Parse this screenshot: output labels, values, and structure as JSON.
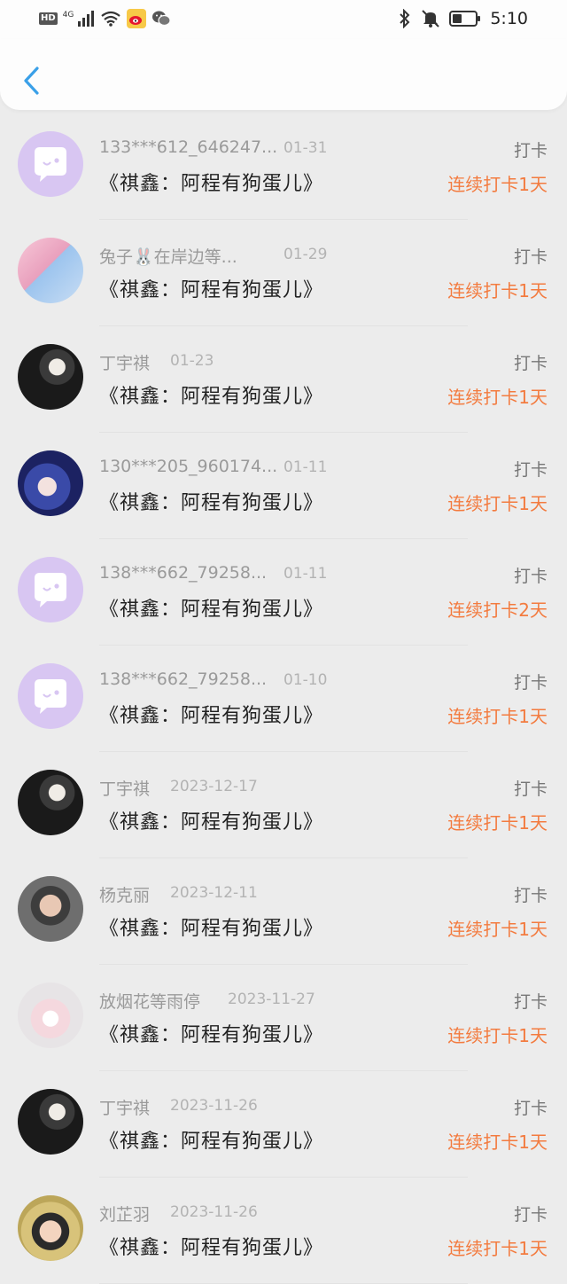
{
  "status_bar": {
    "hd": "HD",
    "network": "4G",
    "time": "5:10",
    "left_icons": [
      "hd-icon",
      "signal-icon",
      "wifi-icon",
      "weibo-icon",
      "wechat-icon"
    ],
    "right_icons": [
      "bluetooth-icon",
      "mute-icon",
      "battery-icon"
    ]
  },
  "header": {
    "back_icon": "chevron-left-icon",
    "accent": "#3aa0e8"
  },
  "colors": {
    "streak": "#f37b3f",
    "name": "#9a9a9a",
    "title": "#222222"
  },
  "records": [
    {
      "name": "133***612_646247...",
      "date": "01-31",
      "title": "《祺鑫：阿程有狗蛋儿》",
      "tag": "打卡",
      "streak": "连续打卡1天",
      "avatar": "purple-chat-icon"
    },
    {
      "name": "兔子🐰在岸边等...",
      "date": "01-29",
      "title": "《祺鑫：阿程有狗蛋儿》",
      "tag": "打卡",
      "streak": "连续打卡1天",
      "avatar": "photo-couple"
    },
    {
      "name": "丁宇祺",
      "date": "01-23",
      "title": "《祺鑫：阿程有狗蛋儿》",
      "tag": "打卡",
      "streak": "连续打卡1天",
      "avatar": "photo-dark"
    },
    {
      "name": "130***205_960174...",
      "date": "01-11",
      "title": "《祺鑫：阿程有狗蛋儿》",
      "tag": "打卡",
      "streak": "连续打卡1天",
      "avatar": "photo-blue"
    },
    {
      "name": "138***662_79258...",
      "date": "01-11",
      "title": "《祺鑫：阿程有狗蛋儿》",
      "tag": "打卡",
      "streak": "连续打卡2天",
      "avatar": "purple-chat-icon"
    },
    {
      "name": "138***662_79258...",
      "date": "01-10",
      "title": "《祺鑫：阿程有狗蛋儿》",
      "tag": "打卡",
      "streak": "连续打卡1天",
      "avatar": "purple-chat-icon"
    },
    {
      "name": "丁宇祺",
      "date": "2023-12-17",
      "title": "《祺鑫：阿程有狗蛋儿》",
      "tag": "打卡",
      "streak": "连续打卡1天",
      "avatar": "photo-dark"
    },
    {
      "name": "杨克丽",
      "date": "2023-12-11",
      "title": "《祺鑫：阿程有狗蛋儿》",
      "tag": "打卡",
      "streak": "连续打卡1天",
      "avatar": "photo-grey"
    },
    {
      "name": "放烟花等雨停",
      "date": "2023-11-27",
      "title": "《祺鑫：阿程有狗蛋儿》",
      "tag": "打卡",
      "streak": "连续打卡1天",
      "avatar": "photo-heart"
    },
    {
      "name": "丁宇祺",
      "date": "2023-11-26",
      "title": "《祺鑫：阿程有狗蛋儿》",
      "tag": "打卡",
      "streak": "连续打卡1天",
      "avatar": "photo-dark"
    },
    {
      "name": "刘芷羽",
      "date": "2023-11-26",
      "title": "《祺鑫：阿程有狗蛋儿》",
      "tag": "打卡",
      "streak": "连续打卡1天",
      "avatar": "photo-child"
    }
  ]
}
